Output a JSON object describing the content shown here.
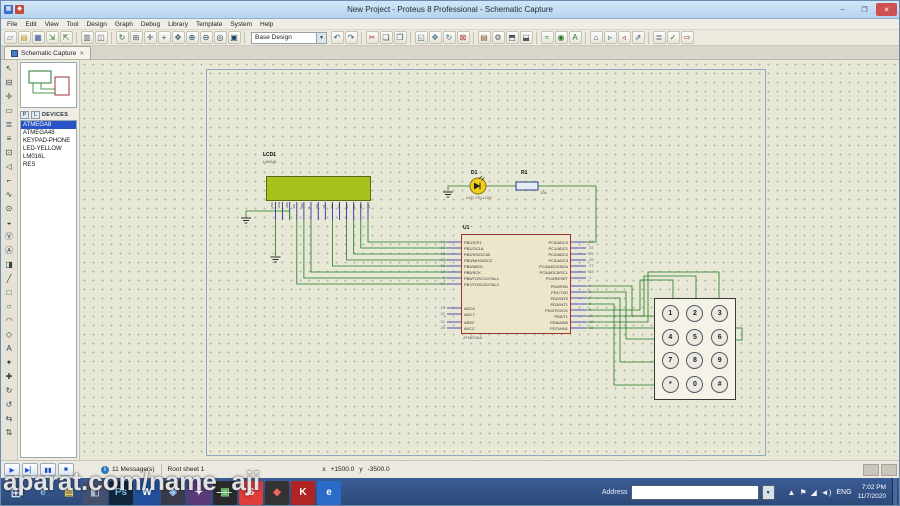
{
  "window": {
    "title": "New Project - Proteus 8 Professional - Schematic Capture",
    "controls": {
      "minimize": "–",
      "maximize": "❐",
      "close": "✕"
    }
  },
  "colors": {
    "selection_blue": "#2a52c8",
    "lcd_green": "#a9c11c",
    "wire_green": "#1f7a1f",
    "chip_border_red": "#a03434",
    "taskbar_blue": "#2c4878",
    "titlebar_blue": "#b5d5ee"
  },
  "menu": {
    "items": [
      "File",
      "Edit",
      "View",
      "Tool",
      "Design",
      "Graph",
      "Debug",
      "Library",
      "Template",
      "System",
      "Help"
    ]
  },
  "toolbar": {
    "combo_value": "Base Design",
    "combo_arrow": "▼",
    "icons_a": [
      {
        "name": "new-file-icon",
        "glyph": "▱",
        "color": "#4a6fa5"
      },
      {
        "name": "open-file-icon",
        "glyph": "▤",
        "color": "#c89a2a"
      },
      {
        "name": "save-icon",
        "glyph": "▦",
        "color": "#3a5a9c"
      },
      {
        "name": "import-icon",
        "glyph": "⇲",
        "color": "#2f7a2f"
      },
      {
        "name": "export-icon",
        "glyph": "⇱",
        "color": "#2f7a2f"
      },
      {
        "k": "sep"
      },
      {
        "name": "print-icon",
        "glyph": "▥",
        "color": "#667"
      },
      {
        "name": "mark-output-area-icon",
        "glyph": "◫",
        "color": "#667"
      },
      {
        "k": "sep"
      },
      {
        "name": "redraw-icon",
        "glyph": "↻",
        "color": "#2a6a2a"
      },
      {
        "name": "grid-toggle-icon",
        "glyph": "⊞",
        "color": "#556"
      },
      {
        "name": "origin-icon",
        "glyph": "✛",
        "color": "#356"
      },
      {
        "name": "cursor-icon",
        "glyph": "+",
        "color": "#356"
      },
      {
        "name": "pan-icon",
        "glyph": "✥",
        "color": "#356"
      },
      {
        "name": "zoom-in-icon",
        "glyph": "⊕",
        "color": "#246"
      },
      {
        "name": "zoom-out-icon",
        "glyph": "⊖",
        "color": "#246"
      },
      {
        "name": "zoom-all-icon",
        "glyph": "◎",
        "color": "#246"
      },
      {
        "name": "zoom-area-icon",
        "glyph": "▣",
        "color": "#246"
      },
      {
        "k": "sep"
      }
    ],
    "icons_b": [
      {
        "name": "undo-icon",
        "glyph": "↶",
        "color": "#335a77"
      },
      {
        "name": "redo-icon",
        "glyph": "↷",
        "color": "#335a77"
      },
      {
        "k": "sep"
      },
      {
        "name": "cut-icon",
        "glyph": "✂",
        "color": "#a33"
      },
      {
        "name": "copy-icon",
        "glyph": "❏",
        "color": "#335a77"
      },
      {
        "name": "paste-icon",
        "glyph": "❐",
        "color": "#335a77"
      },
      {
        "k": "sep"
      },
      {
        "name": "block-copy-icon",
        "glyph": "◱",
        "color": "#44738a"
      },
      {
        "name": "block-move-icon",
        "glyph": "✥",
        "color": "#44738a"
      },
      {
        "name": "block-rotate-icon",
        "glyph": "↻",
        "color": "#44738a"
      },
      {
        "name": "block-delete-icon",
        "glyph": "⊠",
        "color": "#a33"
      },
      {
        "k": "sep"
      },
      {
        "name": "pick-parts-icon",
        "glyph": "▤",
        "color": "#86642a"
      },
      {
        "name": "make-device-icon",
        "glyph": "⚙",
        "color": "#556"
      },
      {
        "name": "packaging-tool-icon",
        "glyph": "⬒",
        "color": "#556"
      },
      {
        "name": "decompose-icon",
        "glyph": "⬓",
        "color": "#556"
      },
      {
        "k": "sep"
      },
      {
        "name": "wire-autorouter-icon",
        "glyph": "≈",
        "color": "#2a7a2a"
      },
      {
        "name": "search-tag-icon",
        "glyph": "◉",
        "color": "#2a7a2a"
      },
      {
        "name": "property-assignment-icon",
        "glyph": "A",
        "color": "#2a7a2a"
      },
      {
        "k": "sep"
      },
      {
        "name": "design-explorer-icon",
        "glyph": "⌂",
        "color": "#335a77"
      },
      {
        "name": "new-sheet-icon",
        "glyph": "▹",
        "color": "#335a77"
      },
      {
        "name": "remove-sheet-icon",
        "glyph": "◃",
        "color": "#a33"
      },
      {
        "name": "goto-sheet-icon",
        "glyph": "⇗",
        "color": "#335a77"
      },
      {
        "k": "sep"
      },
      {
        "name": "bill-of-materials-icon",
        "glyph": "≣",
        "color": "#556"
      },
      {
        "name": "electrical-rule-check-icon",
        "glyph": "✓",
        "color": "#2a7a2a"
      },
      {
        "name": "netlist-to-ares-icon",
        "glyph": "⇨",
        "color": "#a33"
      }
    ]
  },
  "tabs": {
    "active": "Schematic Capture",
    "close": "✕"
  },
  "side_tools": {
    "items": [
      {
        "name": "selection-mode-icon",
        "glyph": "↖"
      },
      {
        "name": "component-mode-icon",
        "glyph": "⊟"
      },
      {
        "name": "junction-dot-mode-icon",
        "glyph": "✛"
      },
      {
        "name": "wire-label-mode-icon",
        "glyph": "▭"
      },
      {
        "name": "text-script-mode-icon",
        "glyph": "≣"
      },
      {
        "name": "buses-mode-icon",
        "glyph": "≡"
      },
      {
        "name": "subcircuit-mode-icon",
        "glyph": "⊡"
      },
      {
        "name": "terminals-mode-icon",
        "glyph": "◁"
      },
      {
        "name": "device-pins-mode-icon",
        "glyph": "⌐"
      },
      {
        "name": "graph-mode-icon",
        "glyph": "∿"
      },
      {
        "name": "tape-recorder-mode-icon",
        "glyph": "⊙"
      },
      {
        "name": "generator-mode-icon",
        "glyph": "◒"
      },
      {
        "name": "voltage-probe-mode-icon",
        "glyph": "Ⓥ"
      },
      {
        "name": "current-probe-mode-icon",
        "glyph": "Ⓐ"
      },
      {
        "name": "virtual-instruments-mode-icon",
        "glyph": "◨"
      },
      {
        "name": "2d-line-mode-icon",
        "glyph": "╱"
      },
      {
        "name": "2d-box-mode-icon",
        "glyph": "□"
      },
      {
        "name": "2d-circle-mode-icon",
        "glyph": "○"
      },
      {
        "name": "2d-arc-mode-icon",
        "glyph": "◠"
      },
      {
        "name": "2d-path-mode-icon",
        "glyph": "◇"
      },
      {
        "name": "2d-text-mode-icon",
        "glyph": "A"
      },
      {
        "name": "2d-symbol-mode-icon",
        "glyph": "✦"
      },
      {
        "name": "2d-marker-mode-icon",
        "glyph": "✚"
      },
      {
        "name": "rotate-clockwise-icon",
        "glyph": "↻"
      },
      {
        "name": "rotate-anticlockwise-icon",
        "glyph": "↺"
      },
      {
        "name": "x-mirror-icon",
        "glyph": "⇆"
      },
      {
        "name": "y-mirror-icon",
        "glyph": "⇅"
      }
    ]
  },
  "devices": {
    "p": "P",
    "l": "L",
    "header": "DEVICES",
    "items": [
      {
        "label": "ATMEGA8",
        "cls": "sel"
      },
      {
        "label": "ATMEGA48"
      },
      {
        "label": "KEYPAD-PHONE"
      },
      {
        "label": "LED-YELLOW"
      },
      {
        "label": "LM016L"
      },
      {
        "label": "RES"
      }
    ]
  },
  "schematic": {
    "lcd": {
      "ref": "LCD1",
      "val": "LM016L",
      "pins": [
        "VSS",
        "VDD",
        "VEE",
        "RS",
        "RW",
        "E",
        "D0",
        "D1",
        "D2",
        "D3",
        "D4",
        "D5",
        "D6",
        "D7"
      ]
    },
    "led": {
      "ref": "D1",
      "val": "LED-YELLOW"
    },
    "res": {
      "ref": "R1",
      "val": "10k"
    },
    "mcu": {
      "ref": "U1",
      "val": "ATMEGA8",
      "pb_names": "PB0/ICP1\nPB1/OC1A\nPB2/SS/OC1B\nPB3/MOSI/OC2\nPB4/MISO\nPB5/SCK\nPB6/TOSC1/XTAL1\nPB7/TOSC2/XTAL2",
      "pb_nums": "14\n15\n16\n17\n18\n19\n9\n10",
      "adc_names": "ADC6\nADC7",
      "adc_nums": "19\n22",
      "pwr_names": "AREF\nAVCC",
      "pwr_nums": "21\n20",
      "pc_names": "PC0/ADC0\nPC1/ADC1\nPC2/ADC2\nPC3/ADC3\nPC4/ADC4/SDA\nPC5/ADC5/SCL\nPC6/RESET",
      "pc_nums": "23\n24\n25\n26\n27\n28\n1",
      "pd_names": "PD0/RXD\nPD1/TXD\nPD2/INT0\nPD3/INT1\nPD4/T0/XCK\nPD5/T1\nPD6/AIN0\nPD7/AIN1",
      "pd_nums": "2\n3\n4\n5\n6\n11\n12\n13"
    },
    "keypad": {
      "keys": [
        "1",
        "2",
        "3",
        "4",
        "5",
        "6",
        "7",
        "8",
        "9",
        "*",
        "0",
        "#"
      ]
    }
  },
  "status": {
    "sim": [
      {
        "name": "play-button",
        "glyph": "▶"
      },
      {
        "name": "step-button",
        "glyph": "▶▏"
      },
      {
        "name": "pause-button",
        "glyph": "▮▮"
      },
      {
        "name": "stop-button",
        "glyph": "■"
      }
    ],
    "message_icon": "i",
    "messages": "11 Message(s)",
    "sheet": "Root sheet 1",
    "x_label": "x",
    "x_value": "+1500.0",
    "y_label": "y",
    "y_value": "-3500.0"
  },
  "taskbar": {
    "start_glyph": "⊞",
    "apps": [
      {
        "name": "internet-explorer-icon",
        "glyph": "e",
        "bg": "transparent",
        "color": "#7ec0f0"
      },
      {
        "name": "file-explorer-icon",
        "glyph": "▤",
        "bg": "transparent",
        "color": "#e8c84a"
      },
      {
        "name": "app-icon-3",
        "glyph": "◧",
        "bg": "#45516a",
        "color": "#aabbd0"
      },
      {
        "name": "photoshop-icon",
        "glyph": "Ps",
        "bg": "#10263a",
        "color": "#7ac0e8"
      },
      {
        "name": "word-icon",
        "glyph": "W",
        "bg": "#1f4e9c",
        "color": "#ffffff"
      },
      {
        "name": "app-icon-6",
        "glyph": "◈",
        "bg": "#3a3a4a",
        "color": "#99ccff"
      },
      {
        "name": "app-icon-7",
        "glyph": "✦",
        "bg": "#5a3a7a",
        "color": "#ffffff"
      },
      {
        "name": "app-icon-8",
        "glyph": "▣",
        "bg": "#2a2a2a",
        "color": "#88ee88"
      },
      {
        "name": "shareit-icon",
        "glyph": "S",
        "bg": "#e03c3c",
        "color": "#ffffff"
      },
      {
        "name": "app-icon-10",
        "glyph": "◆",
        "bg": "#333333",
        "color": "#ee6666"
      },
      {
        "name": "media-app-icon",
        "glyph": "K",
        "bg": "#b02424",
        "color": "#ffffff"
      },
      {
        "name": "edge-icon",
        "glyph": "e",
        "bg": "#2a6ac8",
        "color": "#ffffff"
      }
    ],
    "address_label": "Address",
    "address_arrow": "▼",
    "tray": [
      {
        "name": "show-hidden-icons-icon",
        "glyph": "▲"
      },
      {
        "name": "flag-icon",
        "glyph": "⚑"
      },
      {
        "name": "network-icon",
        "glyph": "◢"
      },
      {
        "name": "volume-icon",
        "glyph": "◄)"
      }
    ],
    "lang": "ENG",
    "time": "7:02 PM",
    "date": "11/7/2020"
  },
  "watermark": "aparat.com/name_aji"
}
